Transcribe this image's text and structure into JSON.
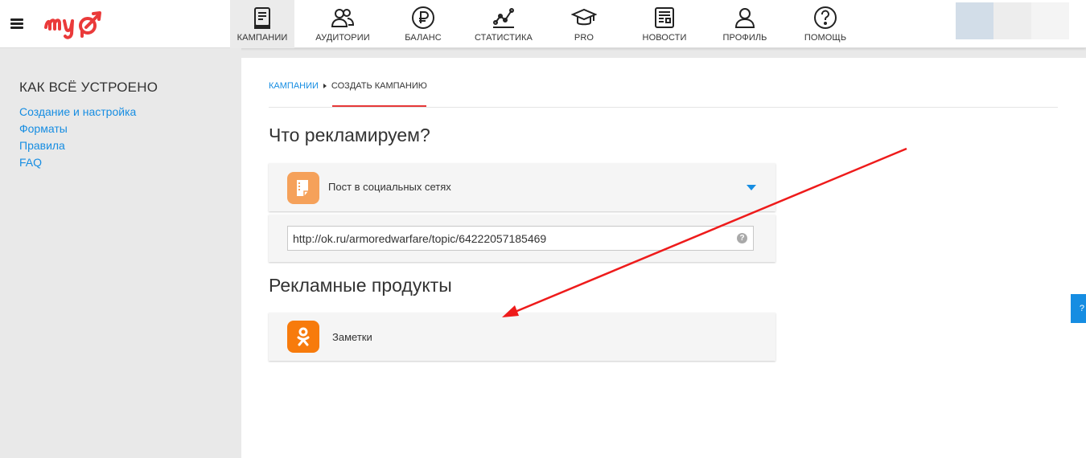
{
  "header": {
    "nav": [
      {
        "label": "КАМПАНИИ",
        "icon": "campaigns-icon",
        "active": true
      },
      {
        "label": "АУДИТОРИИ",
        "icon": "audiences-icon",
        "active": false
      },
      {
        "label": "БАЛАНС",
        "icon": "balance-icon",
        "active": false
      },
      {
        "label": "СТАТИСТИКА",
        "icon": "statistics-icon",
        "active": false
      },
      {
        "label": "PRO",
        "icon": "pro-icon",
        "active": false
      },
      {
        "label": "НОВОСТИ",
        "icon": "news-icon",
        "active": false
      },
      {
        "label": "ПРОФИЛЬ",
        "icon": "profile-icon",
        "active": false
      },
      {
        "label": "ПОМОЩЬ",
        "icon": "help-icon",
        "active": false
      }
    ],
    "user_colors": [
      "#d2dde8",
      "#ededed",
      "#f4f4f4"
    ]
  },
  "sidebar": {
    "title": "КАК ВСЁ УСТРОЕНО",
    "links": [
      "Создание и настройка",
      "Форматы",
      "Правила",
      "FAQ"
    ]
  },
  "breadcrumb": {
    "parent": "КАМПАНИИ",
    "current": "СОЗДАТЬ КАМПАНИЮ"
  },
  "main": {
    "what_title": "Что рекламируем?",
    "object_type": "Пост в социальных сетях",
    "url_value": "http://ok.ru/armoredwarfare/topic/64222057185469",
    "help_symbol": "?",
    "products_title": "Рекламные продукты",
    "product_label": "Заметки"
  },
  "side_tab": {
    "label": "?"
  },
  "colors": {
    "accent_blue": "#168de2",
    "accent_red": "#e63838",
    "post_icon_bg": "#f5a15a",
    "ok_orange": "#f77b0c"
  }
}
